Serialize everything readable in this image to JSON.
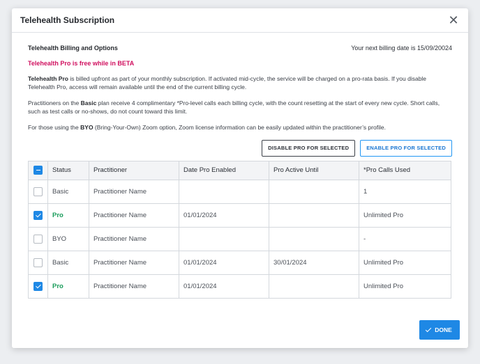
{
  "modal": {
    "title": "Telehealth Subscription",
    "close_icon": "close-icon"
  },
  "billing": {
    "section_title": "Telehealth Billing and Options",
    "next_billing": "Your next billing date is 15/09/20024",
    "beta_notice": "Telehealth Pro is free while in BETA"
  },
  "paragraphs": {
    "p1_bold": "Telehealth Pro",
    "p1_rest": " is billed upfront as part of your monthly subscription. If activated mid-cycle, the service will be charged on a pro-rata basis. If you disable Telehealth Pro, access will remain available until the end of the current billing cycle.",
    "p2_start": "Practitioners on the ",
    "p2_bold": "Basic",
    "p2_rest": " plan receive 4 complimentary *Pro-level calls each billing cycle, with the count resetting at the start of every new cycle. Short calls, such as test calls or no-shows, do not count toward this limit.",
    "p3_start": "For those using the ",
    "p3_bold": "BYO",
    "p3_rest": " (Bring-Your-Own) Zoom option, Zoom license information can be easily updated within the practitioner’s profile."
  },
  "actions": {
    "disable_label": "DISABLE PRO FOR SELECTED",
    "enable_label": "ENABLE PRO FOR SELECTED"
  },
  "table": {
    "headers": [
      "Status",
      "Practitioner",
      "Date Pro Enabled",
      "Pro Active Until",
      "*Pro Calls Used"
    ],
    "rows": [
      {
        "checked": false,
        "status": "Basic",
        "practitioner": "Practitioner Name",
        "date_enabled": "",
        "active_until": "",
        "calls_used": "1"
      },
      {
        "checked": true,
        "status": "Pro",
        "practitioner": "Practitioner Name",
        "date_enabled": "01/01/2024",
        "active_until": "",
        "calls_used": "Unlimited Pro"
      },
      {
        "checked": false,
        "status": "BYO",
        "practitioner": "Practitioner Name",
        "date_enabled": "",
        "active_until": "",
        "calls_used": "-"
      },
      {
        "checked": false,
        "status": "Basic",
        "practitioner": "Practitioner Name",
        "date_enabled": "01/01/2024",
        "active_until": "30/01/2024",
        "calls_used": "Unlimited Pro"
      },
      {
        "checked": true,
        "status": "Pro",
        "practitioner": "Practitioner Name",
        "date_enabled": "01/01/2024",
        "active_until": "",
        "calls_used": "Unlimited Pro"
      }
    ]
  },
  "footer": {
    "done_label": "DONE"
  },
  "colors": {
    "accent": "#1e88e5",
    "beta": "#d0105f",
    "pro_status": "#1a9c5b"
  }
}
